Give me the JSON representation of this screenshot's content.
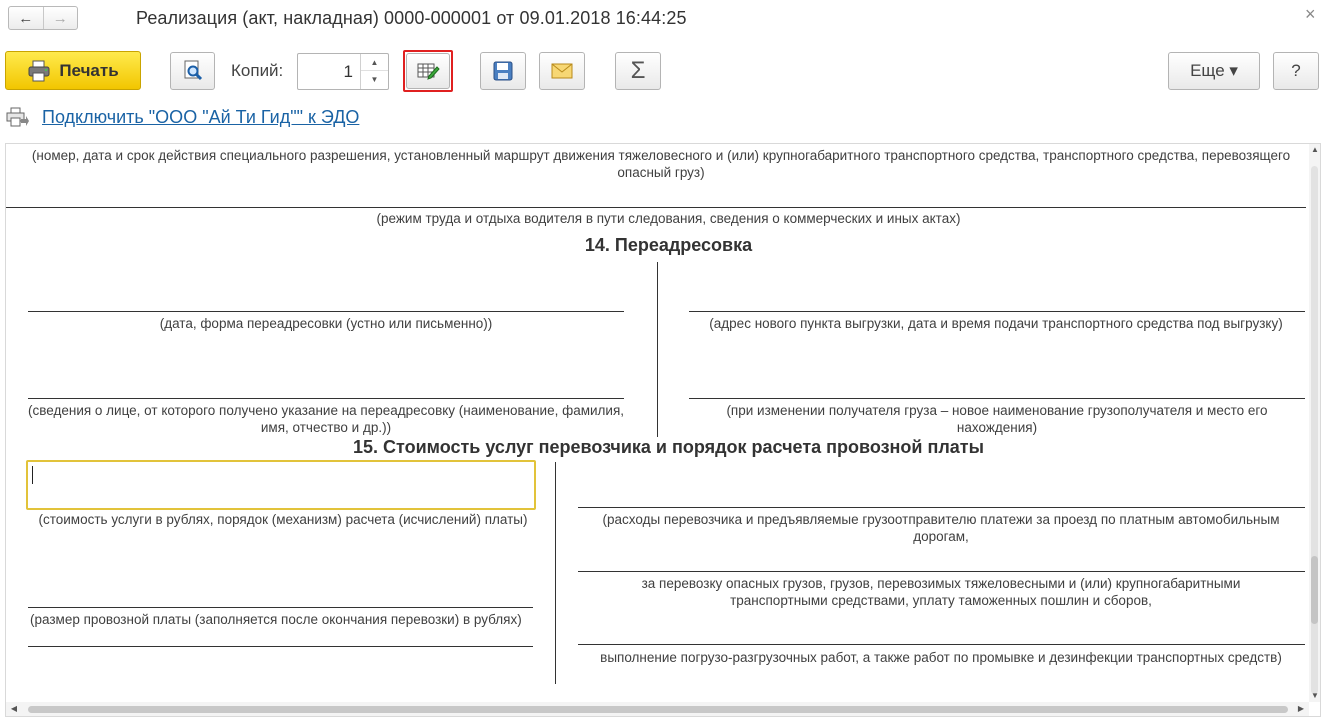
{
  "window": {
    "title": "Реализация (акт, накладная) 0000-000001 от 09.01.2018 16:44:25",
    "back_icon": "arrow-left-icon",
    "forward_icon": "arrow-right-icon",
    "close_label": "×"
  },
  "toolbar": {
    "print_label": "Печать",
    "copies_label": "Копий:",
    "copies_value": "1",
    "more_label": "Еще ▾",
    "help_label": "?",
    "highlight_color": "#e02020"
  },
  "edo": {
    "link_text": "Подключить \"ООО \"Ай Ти Гид\"\" к ЭДО"
  },
  "document": {
    "top_caption": "(номер, дата и срок действия специального разрешения, установленный маршрут движения тяжеловесного и (или) крупногабаритного транспортного средства, транспортного средства, перевозящего опасный груз)",
    "work_rest_caption": "(режим труда и отдыха водителя в пути следования, сведения о коммерческих и иных актах)",
    "section14": {
      "title": "14. Переадресовка",
      "date_form_caption": "(дата, форма переадресовки (устно или письменно))",
      "new_address_caption": "(адрес нового пункта выгрузки, дата и время подачи транспортного средства под выгрузку)",
      "person_caption": "(сведения о лице, от которого получено указание на переадресовку (наименование, фамилия, имя, отчество и др.))",
      "recipient_change_caption": "(при изменении получателя груза – новое наименование грузополучателя и место его нахождения)"
    },
    "section15": {
      "title": "15. Стоимость услуг перевозчика и порядок расчета провозной платы",
      "cost_caption": "(стоимость услуги в рублях, порядок (механизм) расчета (исчислений) платы)",
      "carrier_expenses_caption": "(расходы перевозчика и предъявляемые грузоотправителю платежи за проезд по платным автомобильным дорогам,",
      "dangerous_goods_caption": "за перевозку опасных грузов, грузов, перевозимых тяжеловесными и (или) крупногабаритными транспортными средствами, уплату таможенных пошлин и сборов,",
      "fee_size_caption": "(размер провозной платы (заполняется после окончания перевозки) в рублях)",
      "loading_caption": "выполнение погрузо-разгрузочных работ, а также работ по промывке и дезинфекции транспортных средств)",
      "input_box_color": "#e2c33a"
    }
  }
}
